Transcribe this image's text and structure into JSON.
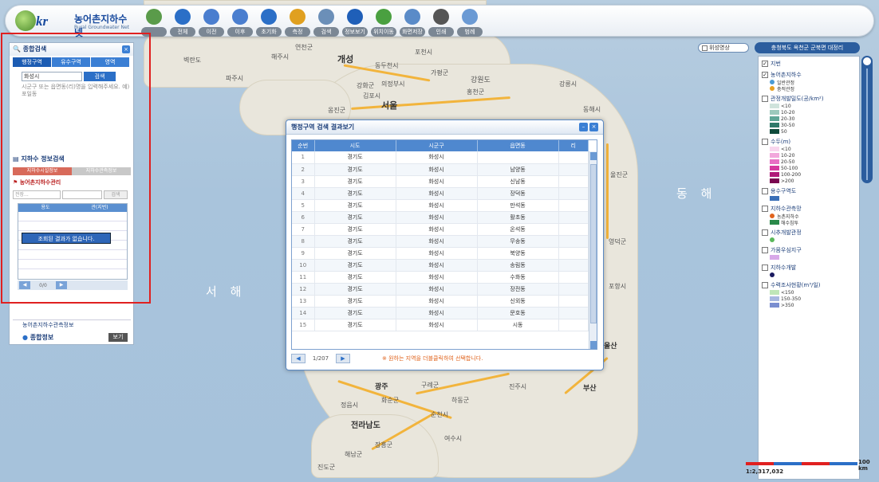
{
  "app": {
    "logo_kr": "kr",
    "title": "농어촌지하수넷",
    "subtitle": "Rural Groundwater Net"
  },
  "toolbar": [
    {
      "label": "",
      "icon": "map-icon",
      "color": "#5a9b4a"
    },
    {
      "label": "전체",
      "icon": "globe-icon",
      "color": "#2b6fc7"
    },
    {
      "label": "이전",
      "icon": "back-arrow-icon",
      "color": "#4a7ecf"
    },
    {
      "label": "이후",
      "icon": "forward-arrow-icon",
      "color": "#4a7ecf"
    },
    {
      "label": "초기화",
      "icon": "refresh-icon",
      "color": "#2b6fc7"
    },
    {
      "label": "측정",
      "icon": "ruler-icon",
      "color": "#e0a020"
    },
    {
      "label": "검색",
      "icon": "magnifier-icon",
      "color": "#6b8fb8"
    },
    {
      "label": "정보보기",
      "icon": "info-icon",
      "color": "#1f5fb8"
    },
    {
      "label": "위치이동",
      "icon": "location-pin-icon",
      "color": "#4aa040"
    },
    {
      "label": "화면저장",
      "icon": "screen-save-icon",
      "color": "#5a8bc8"
    },
    {
      "label": "인쇄",
      "icon": "print-icon",
      "color": "#555555"
    },
    {
      "label": "범례",
      "icon": "legend-icon",
      "color": "#6b9ad4"
    }
  ],
  "map_labels": {
    "sea_west": "서  해",
    "sea_east": "동  해",
    "places": [
      "개성",
      "동두천시",
      "가평군",
      "강원도",
      "의정부시",
      "홍천군",
      "강릉시",
      "서울",
      "동해시",
      "옹진군",
      "울진군",
      "영덕군",
      "포항시",
      "울산",
      "부산",
      "진주시",
      "광주",
      "구례군",
      "하동군",
      "전라남도",
      "순천시",
      "여수시",
      "해남군",
      "장흥군",
      "진도군",
      "강화군",
      "김포시",
      "파주시",
      "연천군",
      "해주시",
      "벽란도",
      "화순군",
      "정읍시",
      "포천시"
    ]
  },
  "left_panel": {
    "title": "종합검색",
    "tabs": [
      "행정구역",
      "유수구역",
      "영역"
    ],
    "search_value": "화성시",
    "search_button": "검색",
    "hint": "시군구 또는 읍면동(리)명을 입력해주세요. 예) 포일동",
    "gw_title": "지하수 정보검색",
    "gw_tabs": [
      "지하수시설정보",
      "지하수관측정보"
    ],
    "mgmt_title": "농어촌지하수관리",
    "filter_select": "전장...",
    "filter_button": "검색",
    "grid_headers": [
      "용도",
      "관(지번)"
    ],
    "no_result": "조회된 결과가 없습니다.",
    "pager_text": "0/0",
    "obs_title": "농어촌지하수관측정보",
    "info_title": "종합정보",
    "view_button": "보기"
  },
  "dialog": {
    "title": "행정구역 검색 결과보기",
    "headers": [
      "순번",
      "시도",
      "시군구",
      "읍면동",
      "리"
    ],
    "rows": [
      [
        "1",
        "경기도",
        "화성시",
        "",
        ""
      ],
      [
        "2",
        "경기도",
        "화성시",
        "남양동",
        ""
      ],
      [
        "3",
        "경기도",
        "화성시",
        "신남동",
        ""
      ],
      [
        "4",
        "경기도",
        "화성시",
        "장덕동",
        ""
      ],
      [
        "5",
        "경기도",
        "화성시",
        "만석동",
        ""
      ],
      [
        "6",
        "경기도",
        "화성시",
        "활초동",
        ""
      ],
      [
        "7",
        "경기도",
        "화성시",
        "온석동",
        ""
      ],
      [
        "8",
        "경기도",
        "화성시",
        "무송동",
        ""
      ],
      [
        "9",
        "경기도",
        "화성시",
        "북양동",
        ""
      ],
      [
        "10",
        "경기도",
        "화성시",
        "송림동",
        ""
      ],
      [
        "11",
        "경기도",
        "화성시",
        "수화동",
        ""
      ],
      [
        "12",
        "경기도",
        "화성시",
        "장전동",
        ""
      ],
      [
        "13",
        "경기도",
        "화성시",
        "신외동",
        ""
      ],
      [
        "14",
        "경기도",
        "화성시",
        "문호동",
        ""
      ],
      [
        "15",
        "경기도",
        "화성시",
        "시동",
        ""
      ]
    ],
    "pager_text": "1/207",
    "note": "※ 원하는 지역을 더블클릭하여 선택합니다."
  },
  "right_panel": {
    "satellite_toggle": "위성영상",
    "location": "충청북도 옥천군 군북면 대정리",
    "groups": [
      {
        "title": "지번",
        "checked": true,
        "items": []
      },
      {
        "title": "농어촌지하수",
        "checked": true,
        "items": [
          {
            "label": "일반관정",
            "color": "#4a9bd4",
            "shape": "dot"
          },
          {
            "label": "충적관정",
            "color": "#e8a020",
            "shape": "dot"
          }
        ]
      },
      {
        "title": "관정개발밀도(공/km²)",
        "checked": false,
        "items": [
          {
            "label": "<10",
            "color": "#cfe3dc",
            "shape": "sw"
          },
          {
            "label": "10-20",
            "color": "#9cc9bc",
            "shape": "sw"
          },
          {
            "label": "20-30",
            "color": "#5fa696",
            "shape": "sw"
          },
          {
            "label": "30-50",
            "color": "#2f7a6a",
            "shape": "sw"
          },
          {
            "label": "50",
            "color": "#0f4b3c",
            "shape": "sw"
          }
        ]
      },
      {
        "title": "수두(m)",
        "checked": false,
        "items": [
          {
            "label": "<10",
            "color": "#f8d6ee",
            "shape": "sw"
          },
          {
            "label": "10-20",
            "color": "#f2a8dc",
            "shape": "sw"
          },
          {
            "label": "20-50",
            "color": "#e86fc4",
            "shape": "sw"
          },
          {
            "label": "50-100",
            "color": "#d6389f",
            "shape": "sw"
          },
          {
            "label": "100-200",
            "color": "#b01878",
            "shape": "sw"
          },
          {
            "label": ">200",
            "color": "#7a0850",
            "shape": "sw"
          }
        ]
      },
      {
        "title": "용수구역도",
        "checked": false,
        "items": [
          {
            "label": "",
            "color": "#3a6fb8",
            "shape": "sw"
          }
        ]
      },
      {
        "title": "지하수관측망",
        "checked": false,
        "items": [
          {
            "label": "농촌지하수",
            "color": "#e0641e",
            "shape": "dot"
          },
          {
            "label": "해수침투",
            "color": "#2a8a4a",
            "shape": "sw"
          }
        ]
      },
      {
        "title": "시추개발관정",
        "checked": false,
        "items": [
          {
            "label": "",
            "color": "#5ab85a",
            "shape": "dot"
          }
        ]
      },
      {
        "title": "가뭄우심지구",
        "checked": false,
        "items": [
          {
            "label": "",
            "color": "#d8a8e8",
            "shape": "sw"
          }
        ]
      },
      {
        "title": "지하수개발",
        "checked": false,
        "items": [
          {
            "label": "",
            "color": "#1a1a60",
            "shape": "dot"
          }
        ]
      },
      {
        "title": "수력조사현황(m³/일)",
        "checked": false,
        "items": [
          {
            "label": "<150",
            "color": "#bfe6b8",
            "shape": "sw"
          },
          {
            "label": "150-350",
            "color": "#a8b8e0",
            "shape": "sw"
          },
          {
            "label": ">350",
            "color": "#7a8ed0",
            "shape": "sw"
          }
        ]
      }
    ]
  },
  "scale": {
    "label": "100 km",
    "ratio": "1:2,317,032"
  }
}
